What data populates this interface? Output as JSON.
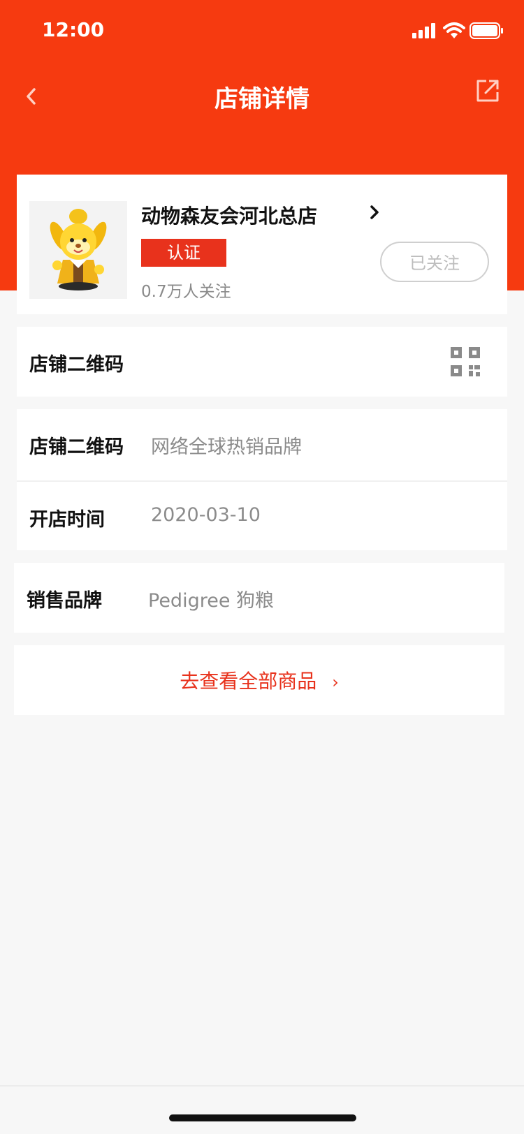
{
  "status_bar": {
    "time": "12:00"
  },
  "nav": {
    "title": "店铺详情",
    "back_icon": "chevron-left-icon",
    "share_icon": "share-icon"
  },
  "store": {
    "name": "动物森友会河北总店",
    "badge": "认证",
    "followers": "0.7万人关注",
    "follow_button": "已关注"
  },
  "qr_row": {
    "label": "店铺二维码",
    "icon": "qr-code-icon"
  },
  "info_rows": [
    {
      "label": "店铺二维码",
      "value": "网络全球热销品牌"
    },
    {
      "label": "开店时间",
      "value": "2020-03-10"
    }
  ],
  "brand_row": {
    "label": "销售品牌",
    "value": "Pedigree 狗粮"
  },
  "cta": {
    "label": "去查看全部商品",
    "arrow": "›"
  },
  "colors": {
    "accent": "#f63a10",
    "badge": "#e8321c",
    "background": "#f7f7f7"
  }
}
